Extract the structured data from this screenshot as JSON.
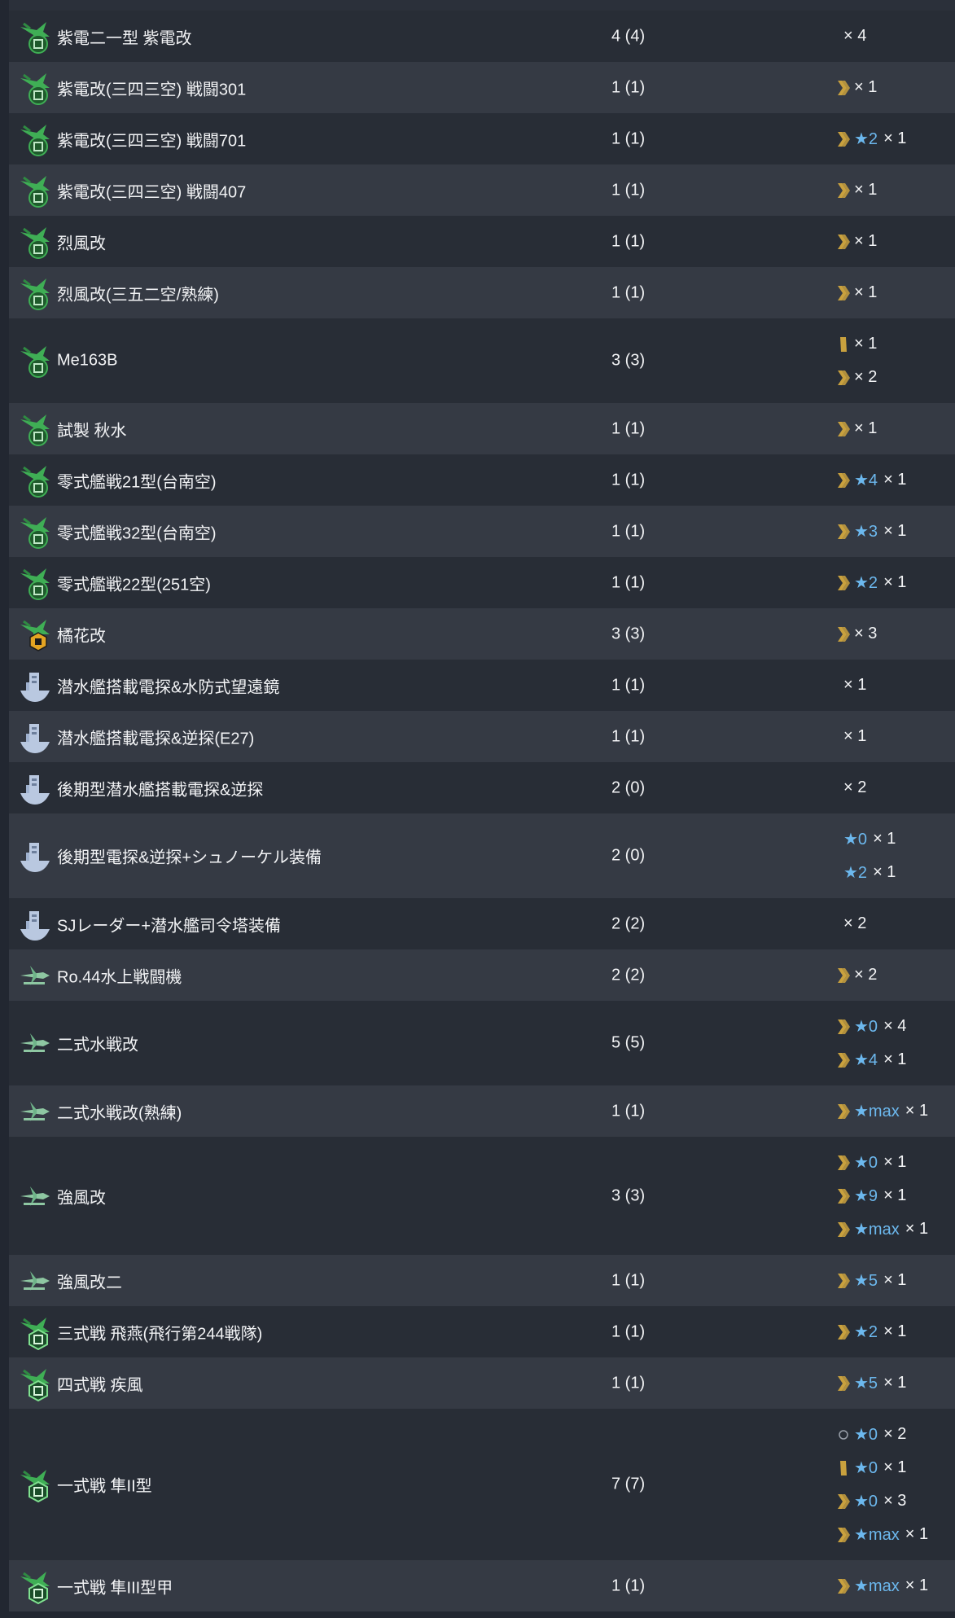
{
  "colors": {
    "row_a": "#282d36",
    "row_b": "#353a44",
    "star": "#6cb8ee",
    "proficiency": "#c9a13e",
    "text": "#f2f3f5"
  },
  "rows": [
    {
      "icon": "fighter-icon-kyoku",
      "name": "紫電二一型 紫電改",
      "count": "4 (4)",
      "details": [
        {
          "prof": "",
          "star": "",
          "qty": "× 4"
        }
      ]
    },
    {
      "icon": "fighter-icon-kyoku",
      "name": "紫電改(三四三空) 戦闘301",
      "count": "1 (1)",
      "details": [
        {
          "prof": "chevron",
          "star": "",
          "qty": "× 1"
        }
      ]
    },
    {
      "icon": "fighter-icon-kyoku",
      "name": "紫電改(三四三空) 戦闘701",
      "count": "1 (1)",
      "details": [
        {
          "prof": "chevron",
          "star": "★2",
          "qty": "× 1"
        }
      ]
    },
    {
      "icon": "fighter-icon-kyoku",
      "name": "紫電改(三四三空) 戦闘407",
      "count": "1 (1)",
      "details": [
        {
          "prof": "chevron",
          "star": "",
          "qty": "× 1"
        }
      ]
    },
    {
      "icon": "fighter-icon-kyoku",
      "name": "烈風改",
      "count": "1 (1)",
      "details": [
        {
          "prof": "chevron",
          "star": "",
          "qty": "× 1"
        }
      ]
    },
    {
      "icon": "fighter-icon-kyoku",
      "name": "烈風改(三五二空/熟練)",
      "count": "1 (1)",
      "details": [
        {
          "prof": "chevron",
          "star": "",
          "qty": "× 1"
        }
      ]
    },
    {
      "icon": "fighter-icon-kyoku",
      "name": "Me163B",
      "count": "3 (3)",
      "details": [
        {
          "prof": "bar",
          "star": "",
          "qty": "× 1"
        },
        {
          "prof": "chevron",
          "star": "",
          "qty": "× 2"
        }
      ]
    },
    {
      "icon": "fighter-icon-kyoku",
      "name": "試製 秋水",
      "count": "1 (1)",
      "details": [
        {
          "prof": "chevron",
          "star": "",
          "qty": "× 1"
        }
      ]
    },
    {
      "icon": "fighter-icon-kyoku",
      "name": "零式艦戦21型(台南空)",
      "count": "1 (1)",
      "details": [
        {
          "prof": "chevron",
          "star": "★4",
          "qty": "× 1"
        }
      ]
    },
    {
      "icon": "fighter-icon-kyoku",
      "name": "零式艦戦32型(台南空)",
      "count": "1 (1)",
      "details": [
        {
          "prof": "chevron",
          "star": "★3",
          "qty": "× 1"
        }
      ]
    },
    {
      "icon": "fighter-icon-kyoku",
      "name": "零式艦戦22型(251空)",
      "count": "1 (1)",
      "details": [
        {
          "prof": "chevron",
          "star": "★2",
          "qty": "× 1"
        }
      ]
    },
    {
      "icon": "fighter-icon-jet",
      "name": "橘花改",
      "count": "3 (3)",
      "details": [
        {
          "prof": "chevron",
          "star": "",
          "qty": "× 3"
        }
      ]
    },
    {
      "icon": "submarine-equipment-icon",
      "name": "潜水艦搭載電探&水防式望遠鏡",
      "count": "1 (1)",
      "details": [
        {
          "prof": "",
          "star": "",
          "qty": "× 1"
        }
      ]
    },
    {
      "icon": "submarine-equipment-icon",
      "name": "潜水艦搭載電探&逆探(E27)",
      "count": "1 (1)",
      "details": [
        {
          "prof": "",
          "star": "",
          "qty": "× 1"
        }
      ]
    },
    {
      "icon": "submarine-equipment-icon",
      "name": "後期型潜水艦搭載電探&逆探",
      "count": "2 (0)",
      "details": [
        {
          "prof": "",
          "star": "",
          "qty": "× 2"
        }
      ]
    },
    {
      "icon": "submarine-equipment-icon",
      "name": "後期型電探&逆探+シュノーケル装備",
      "count": "2 (0)",
      "details": [
        {
          "prof": "",
          "star": "★0",
          "qty": "× 1"
        },
        {
          "prof": "",
          "star": "★2",
          "qty": "× 1"
        }
      ]
    },
    {
      "icon": "submarine-equipment-icon",
      "name": "SJレーダー+潜水艦司令塔装備",
      "count": "2 (2)",
      "details": [
        {
          "prof": "",
          "star": "",
          "qty": "× 2"
        }
      ]
    },
    {
      "icon": "seaplane-fighter-icon",
      "name": "Ro.44水上戦闘機",
      "count": "2 (2)",
      "details": [
        {
          "prof": "chevron",
          "star": "",
          "qty": "× 2"
        }
      ]
    },
    {
      "icon": "seaplane-fighter-icon",
      "name": "二式水戦改",
      "count": "5 (5)",
      "details": [
        {
          "prof": "chevron",
          "star": "★0",
          "qty": "× 4"
        },
        {
          "prof": "chevron",
          "star": "★4",
          "qty": "× 1"
        }
      ]
    },
    {
      "icon": "seaplane-fighter-icon",
      "name": "二式水戦改(熟練)",
      "count": "1 (1)",
      "details": [
        {
          "prof": "chevron",
          "star": "★max",
          "qty": "× 1"
        }
      ]
    },
    {
      "icon": "seaplane-fighter-icon",
      "name": "強風改",
      "count": "3 (3)",
      "details": [
        {
          "prof": "chevron",
          "star": "★0",
          "qty": "× 1"
        },
        {
          "prof": "chevron",
          "star": "★9",
          "qty": "× 1"
        },
        {
          "prof": "chevron",
          "star": "★max",
          "qty": "× 1"
        }
      ]
    },
    {
      "icon": "seaplane-fighter-icon",
      "name": "強風改二",
      "count": "1 (1)",
      "details": [
        {
          "prof": "chevron",
          "star": "★5",
          "qty": "× 1"
        }
      ]
    },
    {
      "icon": "army-fighter-icon",
      "name": "三式戦 飛燕(飛行第244戦隊)",
      "count": "1 (1)",
      "details": [
        {
          "prof": "chevron",
          "star": "★2",
          "qty": "× 1"
        }
      ]
    },
    {
      "icon": "army-fighter-icon",
      "name": "四式戦 疾風",
      "count": "1 (1)",
      "details": [
        {
          "prof": "chevron",
          "star": "★5",
          "qty": "× 1"
        }
      ]
    },
    {
      "icon": "army-fighter-icon",
      "name": "一式戦 隼II型",
      "count": "7 (7)",
      "details": [
        {
          "prof": "circle",
          "star": "★0",
          "qty": "× 2"
        },
        {
          "prof": "bar",
          "star": "★0",
          "qty": "× 1"
        },
        {
          "prof": "chevron",
          "star": "★0",
          "qty": "× 3"
        },
        {
          "prof": "chevron",
          "star": "★max",
          "qty": "× 1"
        }
      ]
    },
    {
      "icon": "army-fighter-icon",
      "name": "一式戦 隼III型甲",
      "count": "1 (1)",
      "details": [
        {
          "prof": "chevron",
          "star": "★max",
          "qty": "× 1"
        }
      ]
    }
  ]
}
